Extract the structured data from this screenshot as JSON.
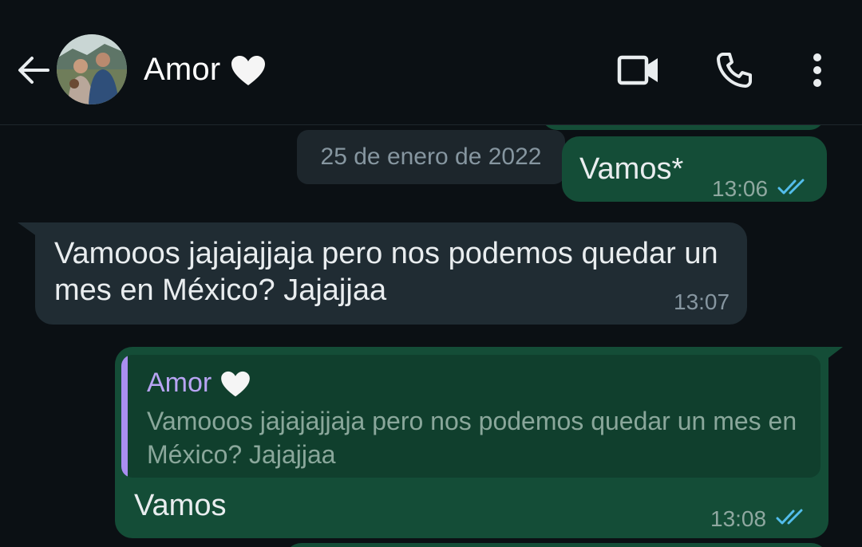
{
  "header": {
    "contact_name": "Amor",
    "contact_emoji": "white-heart-icon",
    "icons": [
      "arrow-left-icon",
      "video-camera-icon",
      "phone-icon",
      "more-vertical-icon"
    ]
  },
  "date_separator": "25 de enero de 2022",
  "messages": [
    {
      "direction": "outgoing",
      "text": "Vamos*",
      "time": "13:06",
      "status": "read"
    },
    {
      "direction": "incoming",
      "text": "Vamooos jajajajjaja pero nos podemos quedar un mes en México? Jajajjaa",
      "time": "13:07"
    },
    {
      "direction": "outgoing",
      "reply_to": {
        "author": "Amor",
        "text": "Vamooos jajajajjaja pero nos podemos quedar un mes en México? Jajajjaa"
      },
      "text": "Vamos",
      "time": "13:08",
      "status": "read"
    }
  ],
  "colors": {
    "background": "#0b1014",
    "outgoing_bubble": "#144d37",
    "incoming_bubble": "#202c33",
    "read_ticks": "#53bdeb",
    "quote_accent": "#a98ef0"
  }
}
